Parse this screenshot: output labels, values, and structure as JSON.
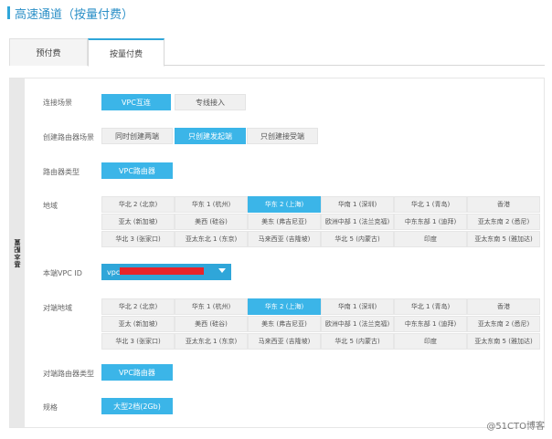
{
  "page": {
    "title": "高速通道（按量付费）"
  },
  "tabs": [
    {
      "label": "预付费",
      "active": false
    },
    {
      "label": "按量付费",
      "active": true
    }
  ],
  "side_label": "基本配置",
  "form": {
    "scene": {
      "label": "连接场景",
      "options": [
        "VPC互连",
        "专线接入"
      ],
      "selected": "VPC互连"
    },
    "router_scene": {
      "label": "创建路由器场景",
      "options": [
        "同时创建两端",
        "只创建发起端",
        "只创建接受端"
      ],
      "selected": "只创建发起端"
    },
    "router_type": {
      "label": "路由器类型",
      "options": [
        "VPC路由器"
      ],
      "selected": "VPC路由器"
    },
    "region": {
      "label": "地域",
      "options": [
        "华北 2 (北京)",
        "华东 1 (杭州)",
        "华东 2 (上海)",
        "华南 1 (深圳)",
        "华北 1 (青岛)",
        "香港",
        "亚太 (新加坡)",
        "美西 (硅谷)",
        "美东 (弗吉尼亚)",
        "欧洲中部 1 (法兰克福)",
        "中东东部 1 (迪拜)",
        "亚太东南 2 (悉尼)",
        "华北 3 (张家口)",
        "亚太东北 1 (东京)",
        "马来西亚 (吉隆坡)",
        "华北 5 (内蒙古)",
        "印度",
        "亚太东南 5 (雅加达)"
      ],
      "selected": "华东 2 (上海)"
    },
    "local_vpc": {
      "label": "本端VPC ID",
      "value": "vpc-"
    },
    "peer_region": {
      "label": "对端地域",
      "options": [
        "华北 2 (北京)",
        "华东 1 (杭州)",
        "华东 2 (上海)",
        "华南 1 (深圳)",
        "华北 1 (青岛)",
        "香港",
        "亚太 (新加坡)",
        "美西 (硅谷)",
        "美东 (弗吉尼亚)",
        "欧洲中部 1 (法兰克福)",
        "中东东部 1 (迪拜)",
        "亚太东南 2 (悉尼)",
        "华北 3 (张家口)",
        "亚太东北 1 (东京)",
        "马来西亚 (吉隆坡)",
        "华北 5 (内蒙古)",
        "印度",
        "亚太东南 5 (雅加达)"
      ],
      "selected": "华东 2 (上海)"
    },
    "peer_router_type": {
      "label": "对端路由器类型",
      "options": [
        "VPC路由器"
      ],
      "selected": "VPC路由器"
    },
    "spec": {
      "label": "规格",
      "options": [
        "大型2档(2Gb)"
      ],
      "selected": "大型2档(2Gb)"
    }
  },
  "watermark": "@51CTO博客",
  "colors": {
    "accent": "#3bb5e8",
    "title": "#2b8fc7",
    "redaction": "#e8242a"
  }
}
